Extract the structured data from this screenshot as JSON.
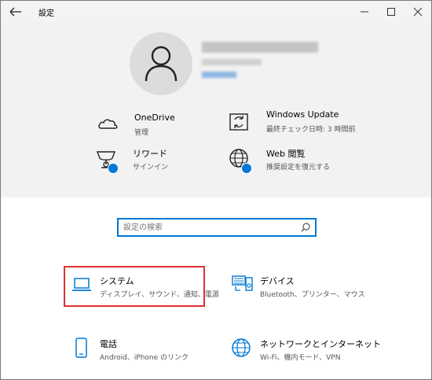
{
  "window": {
    "title": "設定"
  },
  "account": {
    "name": "",
    "email": "",
    "link": ""
  },
  "quick_links": [
    {
      "title": "OneDrive",
      "subtitle": "管理",
      "icon": "cloud-icon"
    },
    {
      "title": "Windows Update",
      "subtitle": "最終チェック日時: 3 時間前",
      "icon": "refresh-icon"
    },
    {
      "title": "リワード",
      "subtitle": "サインイン",
      "icon": "trophy-icon"
    },
    {
      "title": "Web 閲覧",
      "subtitle": "推奨設定を復元する",
      "icon": "globe-icon"
    }
  ],
  "search": {
    "placeholder": "設定の検索",
    "value": ""
  },
  "settings": [
    {
      "title": "システム",
      "description": "ディスプレイ、サウンド、通知、電源",
      "icon": "laptop-icon"
    },
    {
      "title": "デバイス",
      "description": "Bluetooth、プリンター、マウス",
      "icon": "devices-icon"
    },
    {
      "title": "電話",
      "description": "Android、iPhone のリンク",
      "icon": "phone-icon"
    },
    {
      "title": "ネットワークとインターネット",
      "description": "Wi-Fi、機内モード、VPN",
      "icon": "globe-icon"
    }
  ],
  "colors": {
    "accent": "#0078d7",
    "highlight": "#e03030",
    "header_bg": "#f2f2f2"
  }
}
